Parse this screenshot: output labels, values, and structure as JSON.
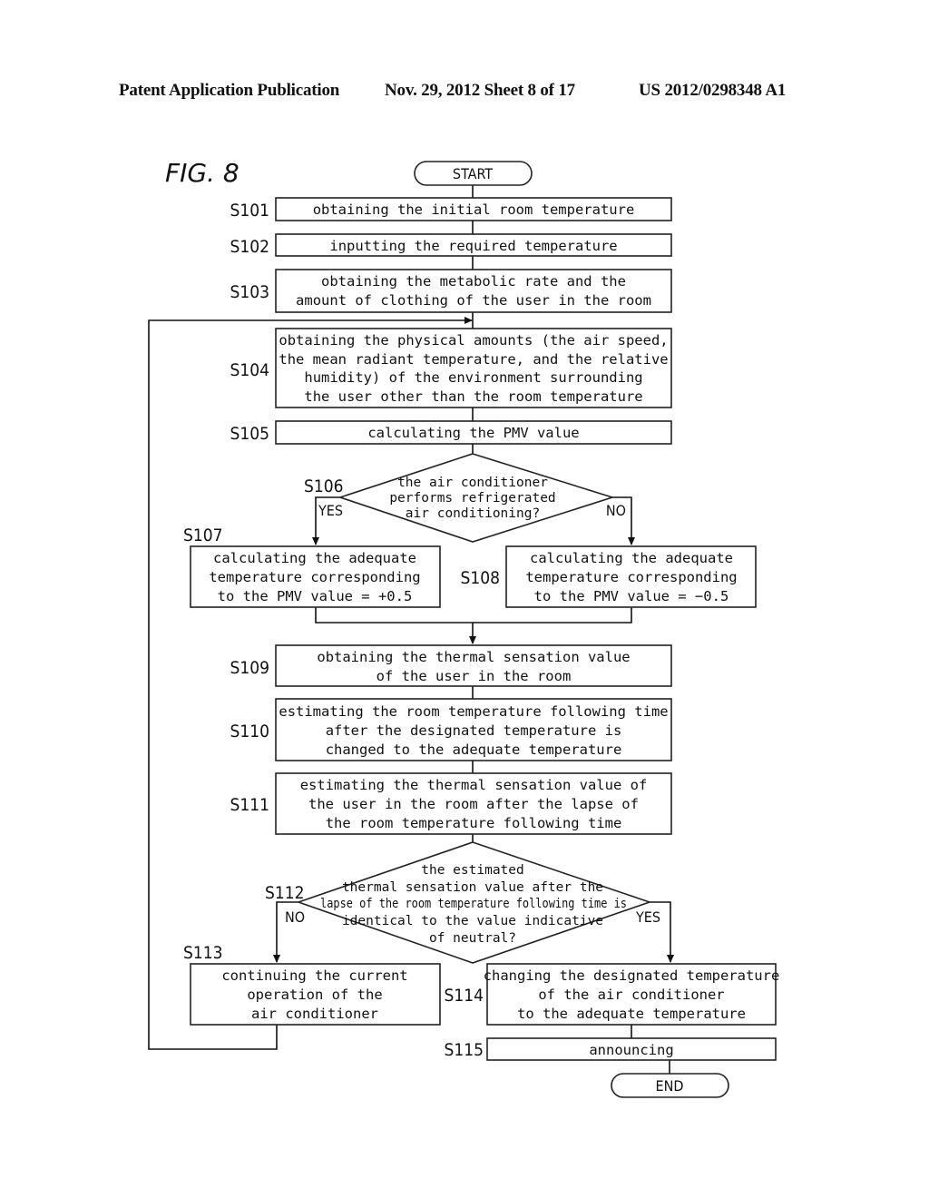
{
  "header": {
    "publication": "Patent Application Publication",
    "date_sheet": "Nov. 29, 2012   Sheet 8 of 17",
    "patent_number": "US 2012/0298348 A1"
  },
  "figure": {
    "label": "FIG. 8"
  },
  "terminals": {
    "start": "START",
    "end": "END"
  },
  "steps": {
    "s101": {
      "id": "S101",
      "lines": [
        "obtaining the initial room temperature"
      ]
    },
    "s102": {
      "id": "S102",
      "lines": [
        "inputting the required temperature"
      ]
    },
    "s103": {
      "id": "S103",
      "lines": [
        "obtaining the metabolic rate and the",
        "amount of clothing of the user in the room"
      ]
    },
    "s104": {
      "id": "S104",
      "lines": [
        "obtaining the physical amounts (the air speed,",
        "the mean radiant temperature, and the relative",
        "humidity) of the environment surrounding",
        "the user other than the room temperature"
      ]
    },
    "s105": {
      "id": "S105",
      "lines": [
        "calculating the PMV value"
      ]
    },
    "s106": {
      "id": "S106",
      "lines": [
        "the air conditioner",
        "performs refrigerated",
        "air conditioning?"
      ],
      "yes": "YES",
      "no": "NO"
    },
    "s107": {
      "id": "S107",
      "lines": [
        "calculating the adequate",
        "temperature corresponding",
        "to the PMV value = +0.5"
      ]
    },
    "s108": {
      "id": "S108",
      "lines": [
        "calculating the adequate",
        "temperature corresponding",
        "to the PMV value = −0.5"
      ]
    },
    "s109": {
      "id": "S109",
      "lines": [
        "obtaining the thermal sensation value",
        "of the user in the room"
      ]
    },
    "s110": {
      "id": "S110",
      "lines": [
        "estimating the room temperature following time",
        "after the designated temperature is",
        "changed to the adequate temperature"
      ]
    },
    "s111": {
      "id": "S111",
      "lines": [
        "estimating the thermal sensation value of",
        "the user in the room after the lapse of",
        "the room temperature following time"
      ]
    },
    "s112": {
      "id": "S112",
      "lines": [
        "the estimated",
        "thermal sensation value after the",
        "lapse of the room temperature following time is",
        "identical to the value indicative",
        "of neutral?"
      ],
      "yes": "YES",
      "no": "NO"
    },
    "s113": {
      "id": "S113",
      "lines": [
        "continuing the current",
        "operation of the",
        "air conditioner"
      ]
    },
    "s114": {
      "id": "S114",
      "lines": [
        "changing the designated temperature",
        "of the air conditioner",
        "to the adequate temperature"
      ]
    },
    "s115": {
      "id": "S115",
      "lines": [
        "announcing"
      ]
    }
  }
}
